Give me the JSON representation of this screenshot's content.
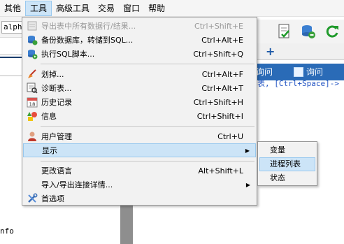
{
  "menubar": {
    "items": [
      {
        "label": "其他"
      },
      {
        "label": "工具"
      },
      {
        "label": "高级工具"
      },
      {
        "label": "交易"
      },
      {
        "label": "窗口"
      },
      {
        "label": "帮助"
      }
    ]
  },
  "left_pane": {
    "combo_value": "alphe",
    "bottom_text": "nfo"
  },
  "result_bar": {
    "query_button_1": "询问",
    "query_button_2": "询问"
  },
  "editor_hint": "表, [Ctrl+Space]-> 列",
  "tabs": {
    "add_label": "+"
  },
  "tools_menu": {
    "items": [
      {
        "label": "导出表中所有数据行/结果...",
        "shortcut": "Ctrl+Shift+E",
        "disabled": true,
        "icon": "export-icon"
      },
      {
        "label": "备份数据库，转储到SQL...",
        "shortcut": "Ctrl+Alt+E",
        "icon": "backup-db-icon"
      },
      {
        "label": "执行SQL脚本...",
        "shortcut": "Ctrl+Shift+Q",
        "icon": "run-sql-icon"
      },
      {
        "label": "划掉...",
        "shortcut": "Ctrl+Alt+F",
        "icon": "broom-icon"
      },
      {
        "label": "诊断表...",
        "shortcut": "Ctrl+Alt+T",
        "icon": "diagnose-icon"
      },
      {
        "label": "历史记录",
        "shortcut": "Ctrl+Shift+H",
        "icon": "calendar-icon"
      },
      {
        "label": "信息",
        "shortcut": "Ctrl+Shift+I",
        "icon": "info-shapes-icon"
      },
      {
        "label": "用户管理",
        "shortcut": "Ctrl+U",
        "icon": "user-icon"
      },
      {
        "label": "显示",
        "shortcut": "",
        "has_submenu": true
      },
      {
        "label": "更改语言",
        "shortcut": "Alt+Shift+L"
      },
      {
        "label": "导入/导出连接详情...",
        "shortcut": "",
        "has_submenu": true
      },
      {
        "label": "首选项",
        "shortcut": "",
        "icon": "wrench-icon"
      }
    ],
    "submenu_arrow": "▶"
  },
  "display_submenu": {
    "items": [
      {
        "label": "变量"
      },
      {
        "label": "进程列表"
      },
      {
        "label": "状态"
      }
    ]
  },
  "colors": {
    "highlight": "#cce4f7",
    "highlight_border": "#99c9ef",
    "result_bar": "#2a6bb7"
  }
}
